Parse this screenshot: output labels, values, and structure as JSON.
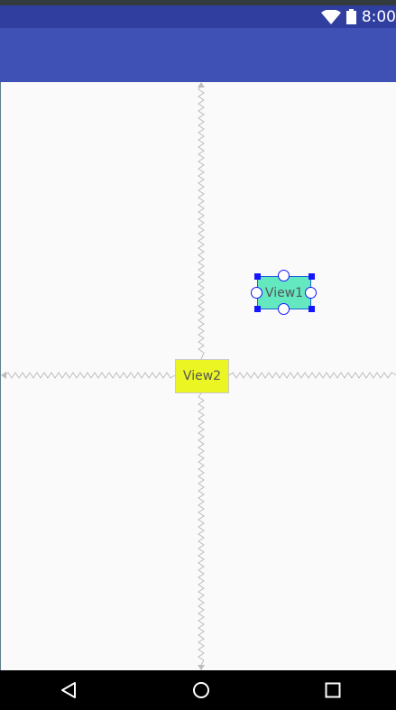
{
  "status_bar": {
    "time": "8:00",
    "icons": [
      "wifi-icon",
      "battery-icon"
    ],
    "color": "#303f9f"
  },
  "app_bar": {
    "color": "#3f51b5"
  },
  "canvas": {
    "background": "#fafafa",
    "views": {
      "view1": {
        "label": "View1",
        "color": "#64e8c0",
        "selected": true
      },
      "view2": {
        "label": "View2",
        "color": "#eaf523",
        "selected": false
      }
    }
  },
  "nav_bar": {
    "icons": [
      "back-icon",
      "home-icon",
      "recents-icon"
    ]
  }
}
